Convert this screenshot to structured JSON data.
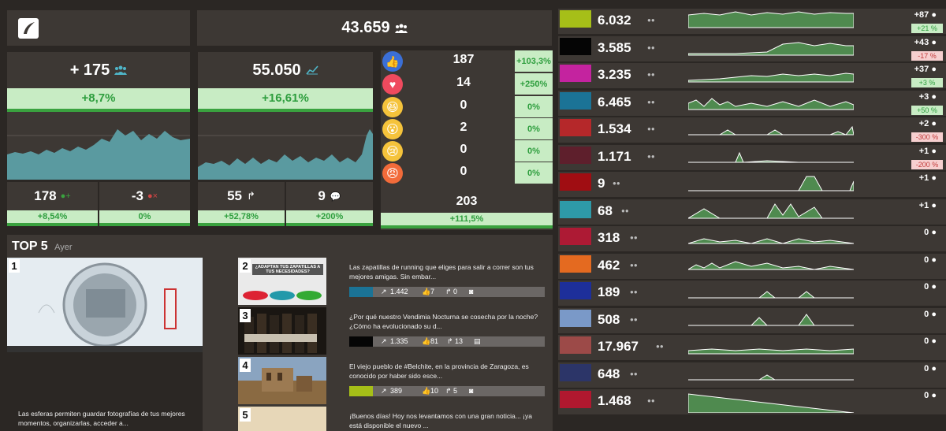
{
  "header": {
    "total_followers": "43.659"
  },
  "growth": {
    "value": "+ 175",
    "pct": "+8,7%"
  },
  "reach": {
    "value": "55.050",
    "pct": "+16,61%"
  },
  "follows": {
    "value": "178",
    "pct": "+8,54%"
  },
  "unfollows": {
    "value": "-3",
    "pct": "0%"
  },
  "shares": {
    "value": "55",
    "pct": "+52,78%"
  },
  "comments": {
    "value": "9",
    "pct": "+200%"
  },
  "reactions": [
    {
      "name": "like",
      "value": "187",
      "pct": "+103,3%",
      "color": "#3b6fd6"
    },
    {
      "name": "love",
      "value": "14",
      "pct": "+250%",
      "color": "#ef4a5e"
    },
    {
      "name": "haha",
      "value": "0",
      "pct": "0%",
      "color": "#f5c33b"
    },
    {
      "name": "wow",
      "value": "2",
      "pct": "0%",
      "color": "#f5c33b"
    },
    {
      "name": "sad",
      "value": "0",
      "pct": "0%",
      "color": "#f5c33b"
    },
    {
      "name": "angry",
      "value": "0",
      "pct": "0%",
      "color": "#f26b3a"
    }
  ],
  "reactions_total": {
    "value": "203",
    "pct": "+111,5%"
  },
  "top5": {
    "title": "TOP 5",
    "subtitle": "Ayer",
    "main_text": "Las esferas permiten guardar fotografías de tus mejores momentos, organizarlas, acceder a...",
    "items": [
      {
        "num": "2",
        "text": "Las zapatillas de running que eliges para salir a correr son tus mejores amigas. Sin embar...",
        "color": "#1b7396",
        "reach": "1.442",
        "likes": "7",
        "shares": "0",
        "thumb_caption": "¿ADAPTAN TUS ZAPATILLAS A TUS NECESIDADES?"
      },
      {
        "num": "3",
        "text": "¿Por qué nuestro Vendimia Nocturna se cosecha por la noche? ¿Cómo ha evolucionado su d...",
        "color": "#050505",
        "reach": "1.335",
        "likes": "81",
        "shares": "13"
      },
      {
        "num": "4",
        "text": "El viejo pueblo de #Belchite, en la provincia de Zaragoza, es conocido por haber sido esce...",
        "color": "#a6bf18",
        "reach": "389",
        "likes": "10",
        "shares": "5"
      },
      {
        "num": "5",
        "text": "¡Buenos días! Hoy nos levantamos con una gran noticia... ¡ya está disponible el nuevo ...",
        "color": "#a6bf18"
      }
    ]
  },
  "pages": [
    {
      "color": "#a6bf18",
      "value": "6.032",
      "delta": "+87",
      "pct": "+21 %",
      "pct_type": "g"
    },
    {
      "color": "#050505",
      "value": "3.585",
      "delta": "+43",
      "pct": "-17 %",
      "pct_type": "r"
    },
    {
      "color": "#c4239f",
      "value": "3.235",
      "delta": "+37",
      "pct": "+3 %",
      "pct_type": "g"
    },
    {
      "color": "#1b7396",
      "value": "6.465",
      "delta": "+3",
      "pct": "+50 %",
      "pct_type": "g"
    },
    {
      "color": "#b5282a",
      "value": "1.534",
      "delta": "+2",
      "pct": "-300 %",
      "pct_type": "r"
    },
    {
      "color": "#5e1f2c",
      "value": "1.171",
      "delta": "+1",
      "pct": "-200 %",
      "pct_type": "r"
    },
    {
      "color": "#a00d12",
      "value": "9",
      "delta": "+1",
      "pct": "",
      "pct_type": ""
    },
    {
      "color": "#2e9aa8",
      "value": "68",
      "delta": "+1",
      "pct": "",
      "pct_type": ""
    },
    {
      "color": "#ad1a34",
      "value": "318",
      "delta": "0",
      "pct": "",
      "pct_type": ""
    },
    {
      "color": "#e46a20",
      "value": "462",
      "delta": "0",
      "pct": "",
      "pct_type": ""
    },
    {
      "color": "#1d2f9a",
      "value": "189",
      "delta": "0",
      "pct": "",
      "pct_type": ""
    },
    {
      "color": "#7a99c8",
      "value": "508",
      "delta": "0",
      "pct": "",
      "pct_type": ""
    },
    {
      "color": "#9c4a48",
      "value": "17.967",
      "delta": "0",
      "pct": "",
      "pct_type": ""
    },
    {
      "color": "#2c3568",
      "value": "648",
      "delta": "0",
      "pct": "",
      "pct_type": ""
    },
    {
      "color": "#b0182f",
      "value": "1.468",
      "delta": "0",
      "pct": "",
      "pct_type": ""
    }
  ]
}
